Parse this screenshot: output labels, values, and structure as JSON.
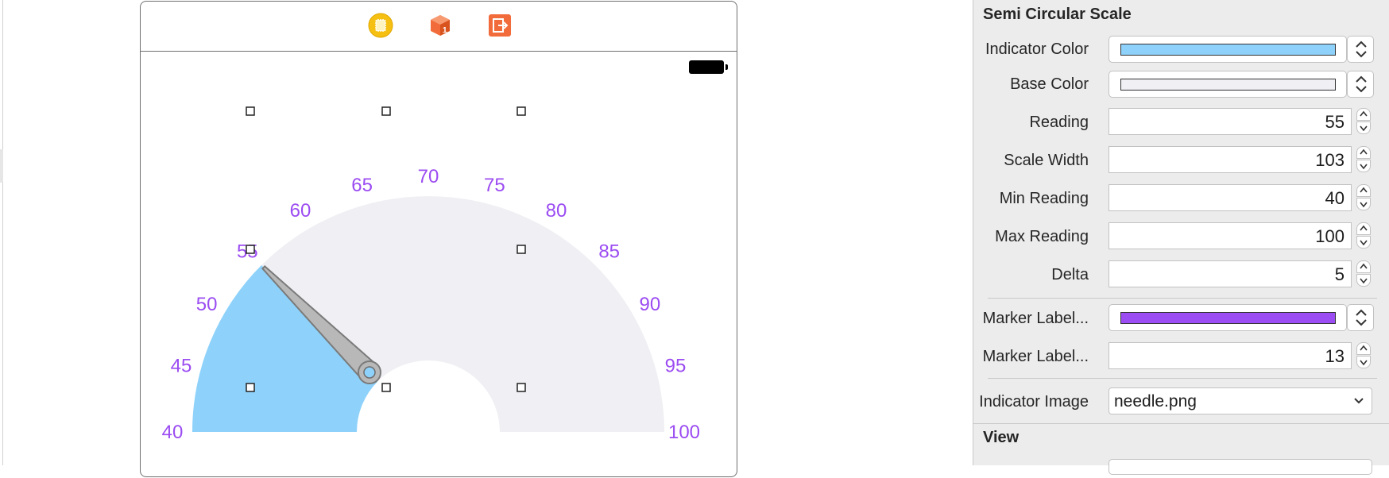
{
  "inspector": {
    "section_title": "Semi Circular Scale",
    "rows": {
      "indicator_color": {
        "label": "Indicator Color",
        "color": "#8ed2fb"
      },
      "base_color": {
        "label": "Base Color",
        "color": "#efeff4"
      },
      "reading": {
        "label": "Reading",
        "value": "55"
      },
      "scale_width": {
        "label": "Scale Width",
        "value": "103"
      },
      "min_reading": {
        "label": "Min Reading",
        "value": "40"
      },
      "max_reading": {
        "label": "Max Reading",
        "value": "100"
      },
      "delta": {
        "label": "Delta",
        "value": "5"
      },
      "marker_label_color": {
        "label": "Marker Label...",
        "color": "#9b4cf2"
      },
      "marker_label_size": {
        "label": "Marker Label...",
        "value": "13"
      },
      "indicator_image": {
        "label": "Indicator Image",
        "value": "needle.png"
      }
    },
    "view_section_title": "View"
  },
  "canvas": {
    "dock_icons": [
      "view-controller-icon",
      "first-responder-icon",
      "exit-icon"
    ],
    "scale": {
      "min": 40,
      "max": 100,
      "delta": 5,
      "reading": 55,
      "marker_labels": [
        "40",
        "45",
        "50",
        "55",
        "60",
        "65",
        "70",
        "75",
        "80",
        "85",
        "90",
        "95",
        "100"
      ],
      "indicator_color": "#8ed2fb",
      "base_color": "#efeff4",
      "marker_label_color": "#9b4cf2"
    }
  }
}
